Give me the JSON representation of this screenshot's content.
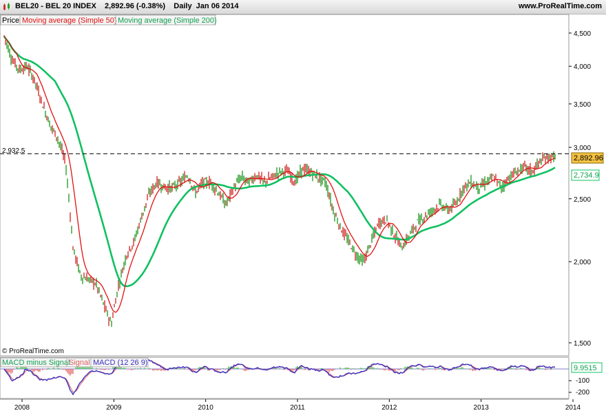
{
  "header": {
    "title": "BEL20 - BEL 20 INDEX    2,892.96 (-0.38%)    Daily  Jan 06 2014",
    "site": "www.ProRealTime.com"
  },
  "legend": {
    "price": "Price",
    "ma50": "Moving average (Simple 50)",
    "ma200": "Moving average (Simple 200)"
  },
  "macd_legend": {
    "hist": "MACD minus Signal",
    "signal": "Signal",
    "macd": "MACD (12 26 9)"
  },
  "copyright": "© ProRealTime.com",
  "colors": {
    "price_up": "#2a9d2a",
    "price_down": "#d23030",
    "ma50": "#e01010",
    "ma200": "#10c060",
    "macd": "#3a30c0",
    "signal": "#e06060",
    "last_price_bg": "#f5c242"
  },
  "chart_data": [
    {
      "type": "line",
      "title": "BEL20 - BEL 20 INDEX",
      "y_scale": "log",
      "ylim": [
        1450,
        4700
      ],
      "x_ticks": [
        "2008",
        "2009",
        "2010",
        "2011",
        "2012",
        "2013",
        "2014"
      ],
      "y_ticks": [
        "4,500",
        "4,000",
        "3,500",
        "3,000",
        "2,500",
        "2,000",
        "1,500"
      ],
      "reference_line": {
        "label": "2,932.5",
        "value": 2932.5
      },
      "last_price_label": "2,892.96",
      "ma200_last_label": "2,734.9",
      "series": [
        {
          "name": "Price",
          "x": [
            "2008-01",
            "2008-02",
            "2008-03",
            "2008-04",
            "2008-05",
            "2008-06",
            "2008-07",
            "2008-08",
            "2008-09",
            "2008-10",
            "2008-11",
            "2008-12",
            "2009-01",
            "2009-02",
            "2009-03",
            "2009-04",
            "2009-05",
            "2009-06",
            "2009-07",
            "2009-08",
            "2009-09",
            "2009-10",
            "2009-11",
            "2009-12",
            "2010-01",
            "2010-02",
            "2010-03",
            "2010-04",
            "2010-05",
            "2010-06",
            "2010-07",
            "2010-08",
            "2010-09",
            "2010-10",
            "2010-11",
            "2010-12",
            "2011-01",
            "2011-02",
            "2011-03",
            "2011-04",
            "2011-05",
            "2011-06",
            "2011-07",
            "2011-08",
            "2011-09",
            "2011-10",
            "2011-11",
            "2011-12",
            "2012-01",
            "2012-02",
            "2012-03",
            "2012-04",
            "2012-05",
            "2012-06",
            "2012-07",
            "2012-08",
            "2012-09",
            "2012-10",
            "2012-11",
            "2012-12",
            "2013-01",
            "2013-02",
            "2013-03",
            "2013-04",
            "2013-05",
            "2013-06",
            "2013-07",
            "2013-08",
            "2013-09",
            "2013-10",
            "2013-11",
            "2013-12",
            "2014-01"
          ],
          "values": [
            4450,
            4100,
            3950,
            4000,
            3800,
            3500,
            3250,
            3100,
            2850,
            2100,
            1900,
            1880,
            1850,
            1720,
            1600,
            1850,
            2050,
            2150,
            2350,
            2550,
            2650,
            2600,
            2600,
            2650,
            2720,
            2550,
            2650,
            2650,
            2550,
            2450,
            2600,
            2700,
            2650,
            2720,
            2650,
            2700,
            2750,
            2760,
            2650,
            2780,
            2750,
            2700,
            2650,
            2400,
            2250,
            2150,
            2050,
            2000,
            2150,
            2300,
            2320,
            2200,
            2100,
            2200,
            2300,
            2350,
            2400,
            2450,
            2400,
            2450,
            2600,
            2650,
            2600,
            2650,
            2700,
            2600,
            2700,
            2750,
            2800,
            2750,
            2850,
            2900,
            2893
          ]
        },
        {
          "name": "Moving average (Simple 50)"
        },
        {
          "name": "Moving average (Simple 200)"
        }
      ]
    },
    {
      "type": "bar",
      "title": "MACD (12 26 9)",
      "y_ticks": [
        "-100",
        "-200"
      ],
      "last_value_label": "9.9515",
      "series": [
        {
          "name": "MACD minus Signal"
        },
        {
          "name": "Signal"
        },
        {
          "name": "MACD (12 26 9)"
        }
      ]
    }
  ]
}
